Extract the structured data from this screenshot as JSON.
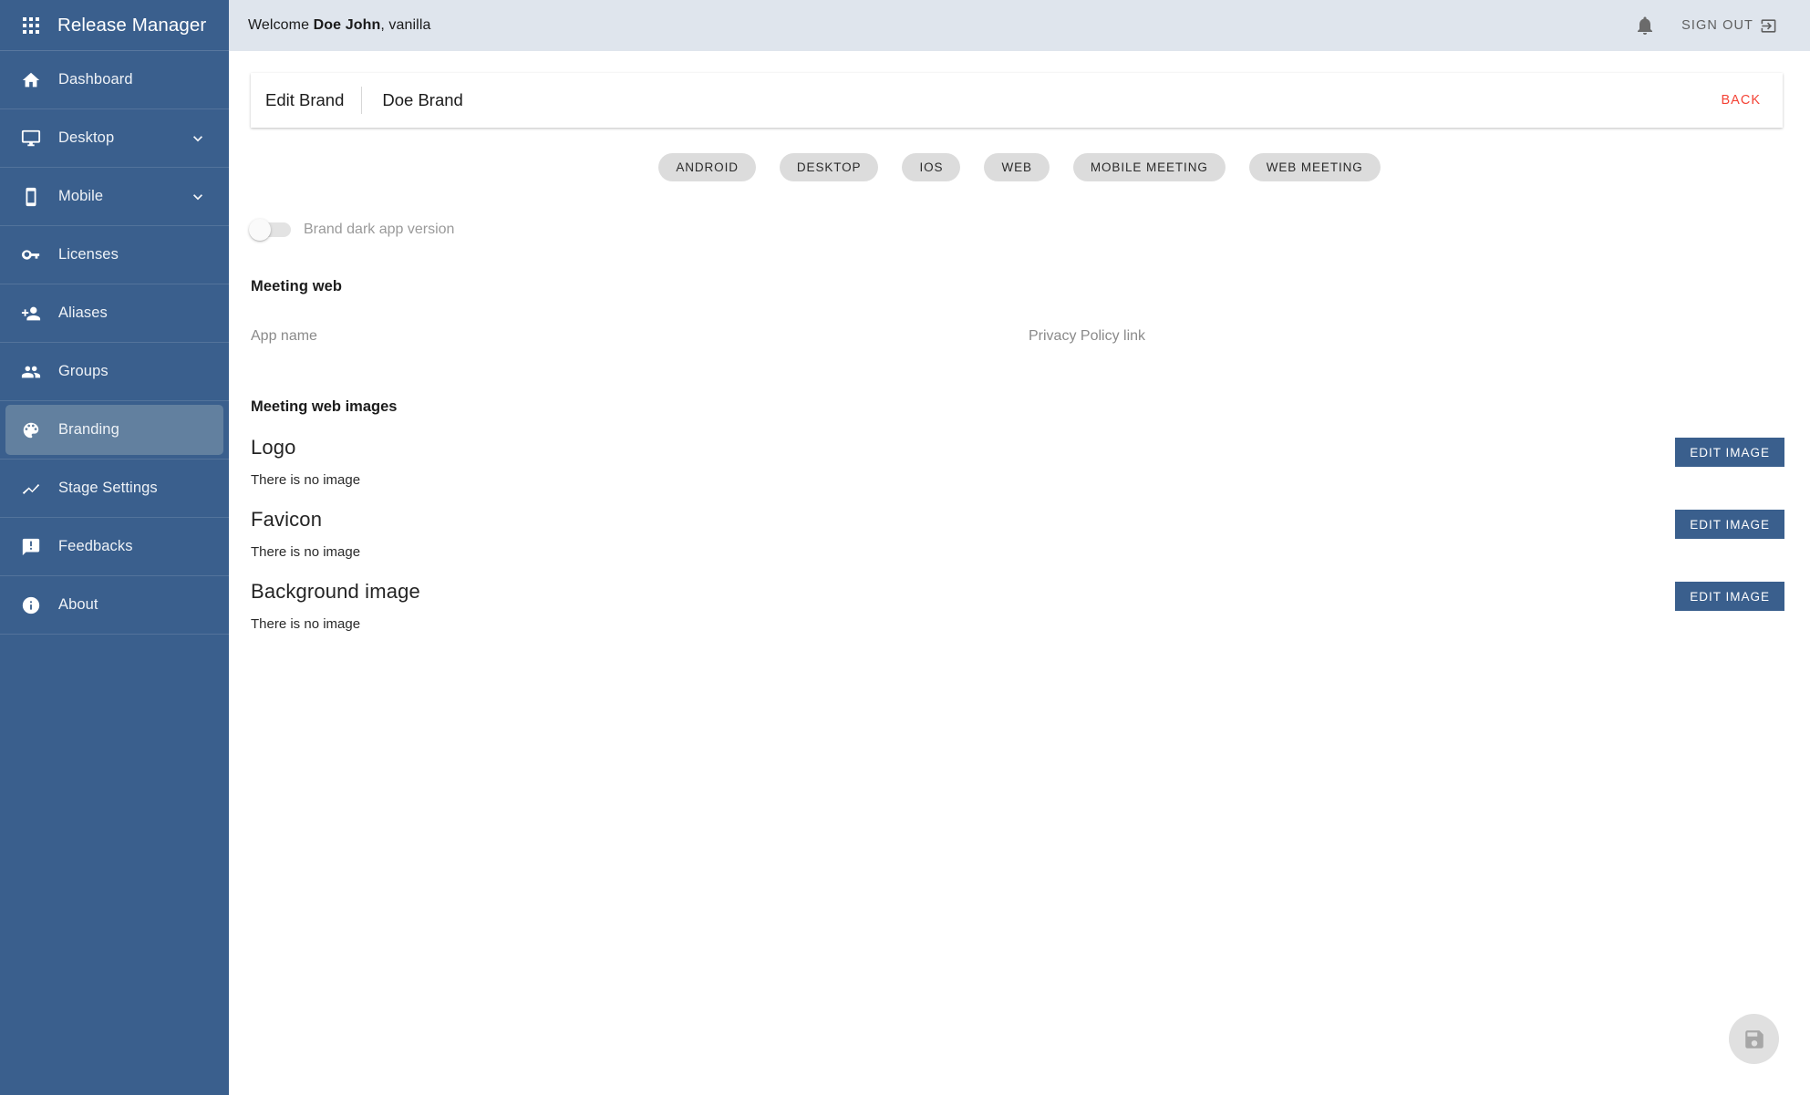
{
  "sidebar": {
    "brand_title": "Release Manager",
    "apps_icon": "apps-grid-icon",
    "items": [
      {
        "label": "Dashboard",
        "icon": "home-icon",
        "expandable": false,
        "active": false
      },
      {
        "label": "Desktop",
        "icon": "monitor-icon",
        "expandable": true,
        "active": false
      },
      {
        "label": "Mobile",
        "icon": "smartphone-icon",
        "expandable": true,
        "active": false
      },
      {
        "label": "Licenses",
        "icon": "key-icon",
        "expandable": false,
        "active": false
      },
      {
        "label": "Aliases",
        "icon": "person-add-icon",
        "expandable": false,
        "active": false
      },
      {
        "label": "Groups",
        "icon": "people-icon",
        "expandable": false,
        "active": false
      },
      {
        "label": "Branding",
        "icon": "palette-icon",
        "expandable": false,
        "active": true
      },
      {
        "label": "Stage Settings",
        "icon": "timeline-icon",
        "expandable": false,
        "active": false
      },
      {
        "label": "Feedbacks",
        "icon": "feedback-icon",
        "expandable": false,
        "active": false
      },
      {
        "label": "About",
        "icon": "info-icon",
        "expandable": false,
        "active": false
      }
    ]
  },
  "topbar": {
    "welcome_prefix": "Welcome ",
    "user_name": "Doe John",
    "welcome_suffix": ", vanilla",
    "bell_icon": "notifications-bell-icon",
    "signout_label": "SIGN OUT",
    "signout_icon": "exit-to-app-icon"
  },
  "title_card": {
    "main": "Edit Brand",
    "sub": "Doe Brand",
    "back_label": "BACK",
    "back_color": "#f44336"
  },
  "chips": [
    {
      "label": "ANDROID"
    },
    {
      "label": "DESKTOP"
    },
    {
      "label": "IOS"
    },
    {
      "label": "WEB"
    },
    {
      "label": "MOBILE MEETING"
    },
    {
      "label": "WEB MEETING"
    }
  ],
  "dark_toggle": {
    "label": "Brand dark app version",
    "checked": false
  },
  "meeting_web": {
    "heading": "Meeting web",
    "app_name": {
      "placeholder": "App name",
      "value": ""
    },
    "privacy_policy": {
      "placeholder": "Privacy Policy link",
      "value": ""
    }
  },
  "images_section": {
    "heading": "Meeting web images",
    "edit_label": "EDIT IMAGE",
    "rows": [
      {
        "name": "Logo",
        "state": "There is no image"
      },
      {
        "name": "Favicon",
        "state": "There is no image"
      },
      {
        "name": "Background image",
        "state": "There is no image"
      }
    ]
  },
  "fab": {
    "icon": "save-icon",
    "enabled": false
  },
  "colors": {
    "sidebar_bg": "#3a5f8d",
    "sidebar_active": "#62809f",
    "topbar_bg": "#dfe5ed",
    "accent_button": "#3a5f8d",
    "chip_bg": "#dcdcdc",
    "danger": "#f44336"
  }
}
